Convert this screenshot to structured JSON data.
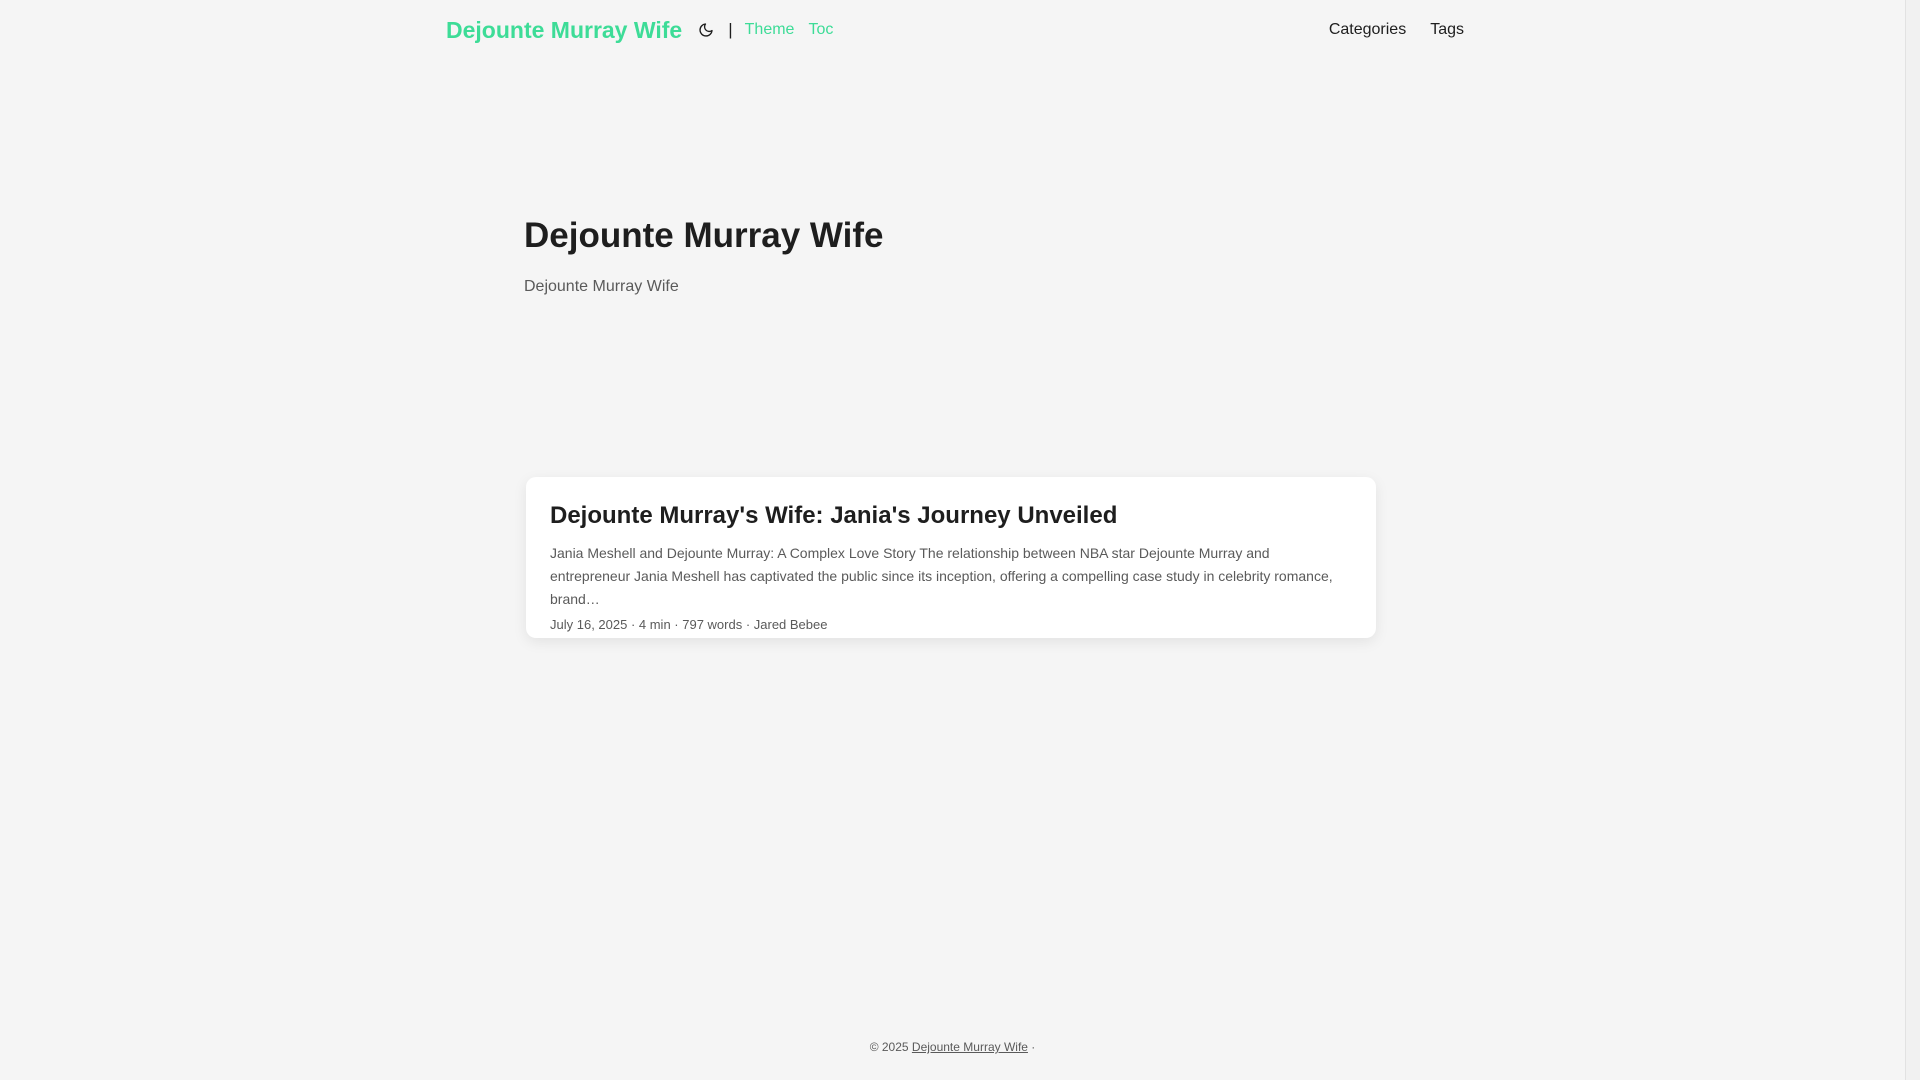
{
  "header": {
    "site_title": "Dejounte Murray Wife",
    "theme_icon": "moon-icon",
    "separator": "|",
    "links": [
      "Theme",
      "Toc"
    ],
    "nav": [
      "Categories",
      "Tags"
    ]
  },
  "hero": {
    "title": "Dejounte Murray Wife",
    "subtitle": "Dejounte Murray Wife"
  },
  "posts": [
    {
      "title": "Dejounte Murray's Wife: Jania's Journey Unveiled",
      "excerpt": "Jania Meshell and Dejounte Murray: A Complex Love Story The relationship between NBA star Dejounte Murray and entrepreneur Jania Meshell has captivated the public since its inception, offering a compelling case study in celebrity romance, brand…",
      "meta": "July 16, 2025 · 4 min · 797 words · Jared Bebee"
    }
  ],
  "footer": {
    "copyright": "© 2025",
    "site_link": "Dejounte Murray Wife",
    "trailing": "·"
  },
  "colors": {
    "accent": "#3ddc97",
    "background": "#f5f5f5",
    "text": "#1e1e1e",
    "muted": "#5a5a5a"
  }
}
